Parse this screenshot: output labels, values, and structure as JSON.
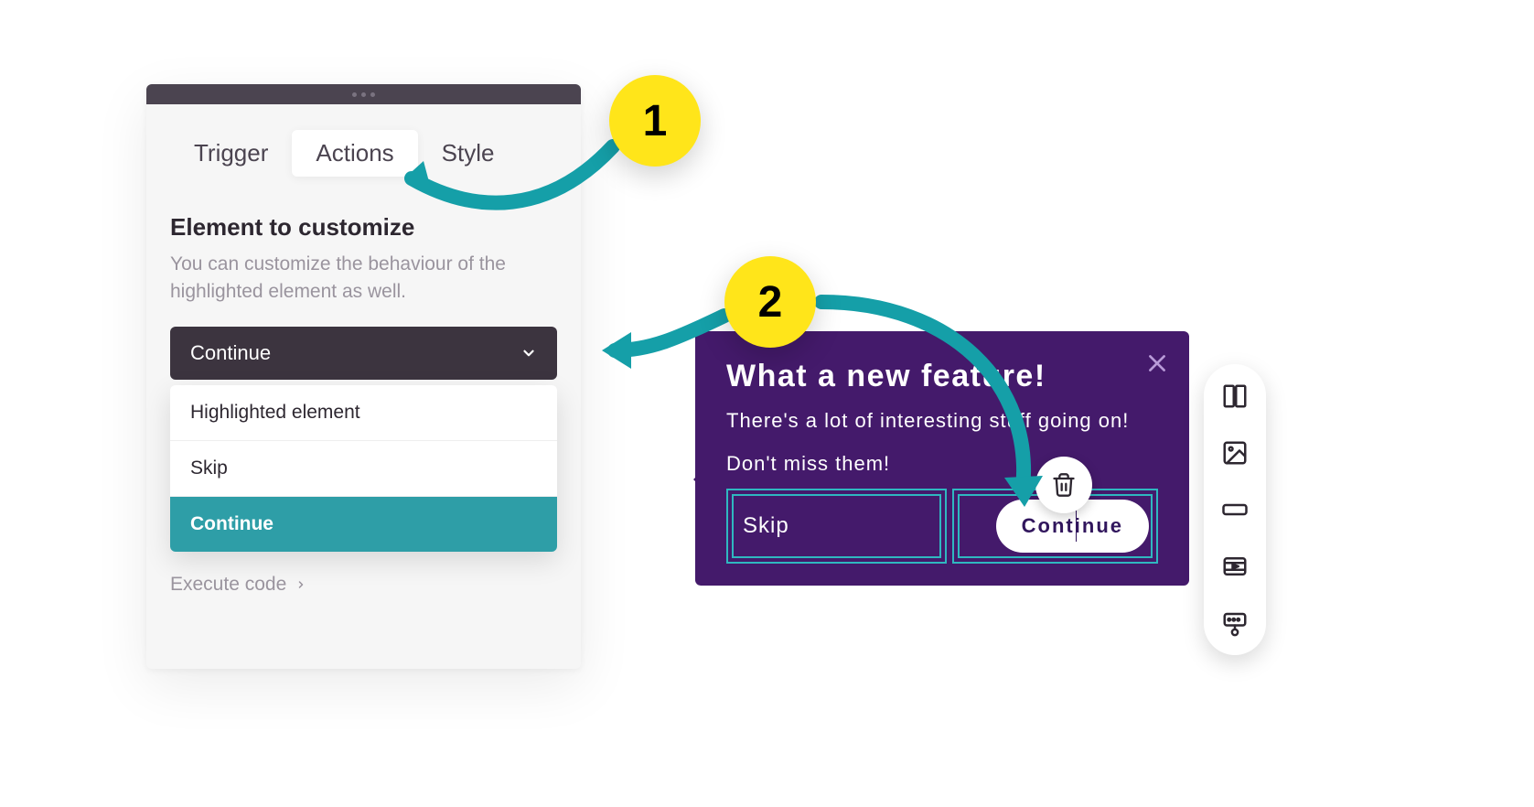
{
  "panel": {
    "tabs": {
      "trigger": "Trigger",
      "actions": "Actions",
      "style": "Style"
    },
    "section_title": "Element to customize",
    "section_desc": "You can customize the behaviour of the highlighted element as well.",
    "select_value": "Continue",
    "options": {
      "highlighted": "Highlighted element",
      "skip": "Skip",
      "continue": "Continue"
    },
    "execute_code": "Execute code"
  },
  "card": {
    "title": "What a new feature!",
    "body": "There's a lot of interesting stuff going on!",
    "body2": "Don't miss them!",
    "skip": "Skip",
    "continue": "Continue"
  },
  "badges": {
    "one": "1",
    "two": "2"
  },
  "palette_icons": {
    "columns": "columns-icon",
    "image": "image-icon",
    "button": "button-icon",
    "video": "video-icon",
    "survey": "survey-icon"
  }
}
